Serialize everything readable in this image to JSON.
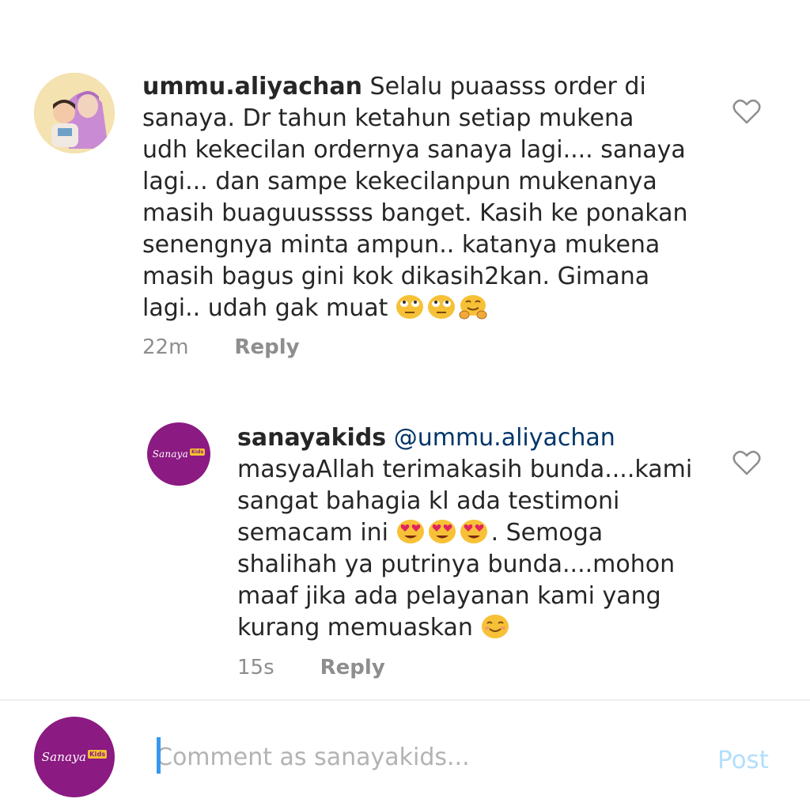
{
  "comments": [
    {
      "username": "ummu.aliyachan",
      "lines": [
        "Selalu puaasss order di",
        "sanaya. Dr tahun ketahun setiap mukena",
        "udh kekecilan ordernya sanaya lagi.... sanaya",
        "lagi... dan sampe kekecilanpun mukenanya",
        "masih buaguusssss banget. Kasih ke ponakan",
        "senengnya minta ampun.. katanya mukena",
        "masih bagus gini kok dikasih2kan. Gimana",
        "lagi.. udah gak muat"
      ],
      "emojis": [
        "face-with-rolling-eyes",
        "face-with-rolling-eyes",
        "hugging-face"
      ],
      "time": "22m",
      "reply_label": "Reply"
    },
    {
      "username": "sanayakids",
      "mention": "@ummu.aliyachan",
      "lines": [
        "masyaAllah terimakasih bunda....kami",
        "sangat bahagia kl ada testimoni",
        "semacam ini",
        ". Semoga",
        "shalihah ya putrinya bunda....mohon",
        "maaf jika ada pelayanan kami yang",
        "kurang memuaskan"
      ],
      "emojis": [
        "heart-eyes",
        "heart-eyes",
        "heart-eyes",
        "smiling-face"
      ],
      "time": "15s",
      "reply_label": "Reply"
    }
  ],
  "brand_avatar": {
    "name": "Sanaya",
    "badge": "Kids"
  },
  "composer": {
    "placeholder": "Comment as sanayakids...",
    "post_label": "Post"
  },
  "colors": {
    "brand_purple": "#8b1a82",
    "link_blue": "#003569",
    "post_disabled": "#b2dffc",
    "meta_gray": "#8e8e8e",
    "caret_blue": "#3897f0"
  }
}
